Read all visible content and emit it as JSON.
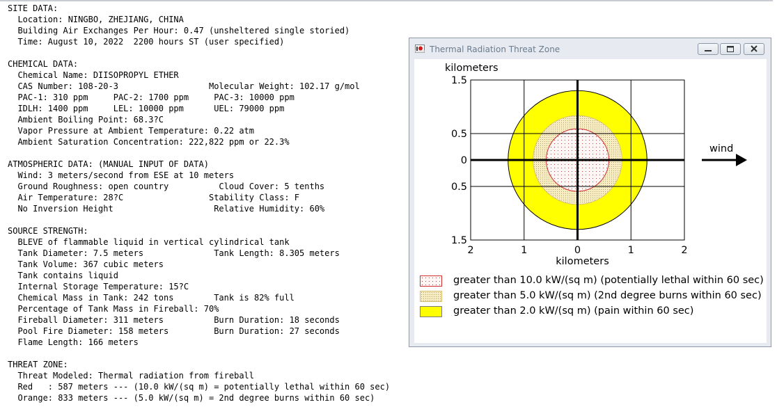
{
  "report_lines": [
    "SITE DATA:",
    "  Location: NINGBO, ZHEJIANG, CHINA",
    "  Building Air Exchanges Per Hour: 0.47 (unsheltered single storied)",
    "  Time: August 10, 2022  2200 hours ST (user specified)",
    "",
    "CHEMICAL DATA:",
    "  Chemical Name: DIISOPROPYL ETHER",
    "  CAS Number: 108-20-3                  Molecular Weight: 102.17 g/mol",
    "  PAC-1: 310 ppm     PAC-2: 1700 ppm     PAC-3: 10000 ppm",
    "  IDLH: 1400 ppm     LEL: 10000 ppm      UEL: 79000 ppm",
    "  Ambient Boiling Point: 68.3?C",
    "  Vapor Pressure at Ambient Temperature: 0.22 atm",
    "  Ambient Saturation Concentration: 222,822 ppm or 22.3%",
    "",
    "ATMOSPHERIC DATA: (MANUAL INPUT OF DATA)",
    "  Wind: 3 meters/second from ESE at 10 meters",
    "  Ground Roughness: open country          Cloud Cover: 5 tenths",
    "  Air Temperature: 28?C                 Stability Class: F",
    "  No Inversion Height                    Relative Humidity: 60%",
    "",
    "SOURCE STRENGTH:",
    "  BLEVE of flammable liquid in vertical cylindrical tank",
    "  Tank Diameter: 7.5 meters              Tank Length: 8.305 meters",
    "  Tank Volume: 367 cubic meters",
    "  Tank contains liquid",
    "  Internal Storage Temperature: 15?C",
    "  Chemical Mass in Tank: 242 tons        Tank is 82% full",
    "  Percentage of Tank Mass in Fireball: 70%",
    "  Fireball Diameter: 311 meters          Burn Duration: 18 seconds",
    "  Pool Fire Diameter: 158 meters         Burn Duration: 27 seconds",
    "  Flame Length: 166 meters",
    "",
    "THREAT ZONE:",
    "  Threat Modeled: Thermal radiation from fireball",
    "  Red   : 587 meters --- (10.0 kW/(sq m) = potentially lethal within 60 sec)",
    "  Orange: 833 meters --- (5.0 kW/(sq m) = 2nd degree burns within 60 sec)"
  ],
  "window": {
    "title": "Thermal Radiation Threat Zone",
    "minimize_icon": "minimize-icon",
    "maximize_icon": "maximize-icon",
    "close_icon": "close-icon"
  },
  "chart_data": {
    "type": "threat-zone-plot",
    "ylabel": "kilometers",
    "xlabel": "kilometers",
    "x_ticks": [
      "2",
      "1",
      "0",
      "1",
      "2"
    ],
    "x_tick_values": [
      -2,
      -1,
      0,
      1,
      2
    ],
    "y_ticks": [
      "1.5",
      "0.5",
      "0",
      "0.5",
      "1.5"
    ],
    "y_tick_values": [
      1.5,
      0.5,
      0,
      -0.5,
      -1.5
    ],
    "xlim": [
      -2,
      2
    ],
    "ylim": [
      -1.5,
      1.5
    ],
    "grid": true,
    "zones": [
      {
        "name": "yellow",
        "radius_km": 1.3,
        "fill": "#ffff00",
        "stroke": "#000000"
      },
      {
        "name": "orange",
        "radius_km": 0.833,
        "fill": "#f3e9b8",
        "stroke": "#d8c070"
      },
      {
        "name": "red",
        "radius_km": 0.587,
        "fill": "#fff3f3",
        "stroke": "#d03030"
      }
    ],
    "wind_label": "wind",
    "wind_direction": "right"
  },
  "legend": [
    {
      "text": "greater than 10.0 kW/(sq m) (potentially lethal within 60 sec)",
      "swatch": "red"
    },
    {
      "text": "greater than 5.0 kW/(sq m) (2nd degree burns within 60 sec)",
      "swatch": "orange"
    },
    {
      "text": "greater than 2.0 kW/(sq m) (pain within 60 sec)",
      "swatch": "yellow"
    }
  ],
  "colors": {
    "yellow": "#ffff00",
    "orange_fill": "#f3e9b8",
    "red_stroke": "#d03030"
  }
}
